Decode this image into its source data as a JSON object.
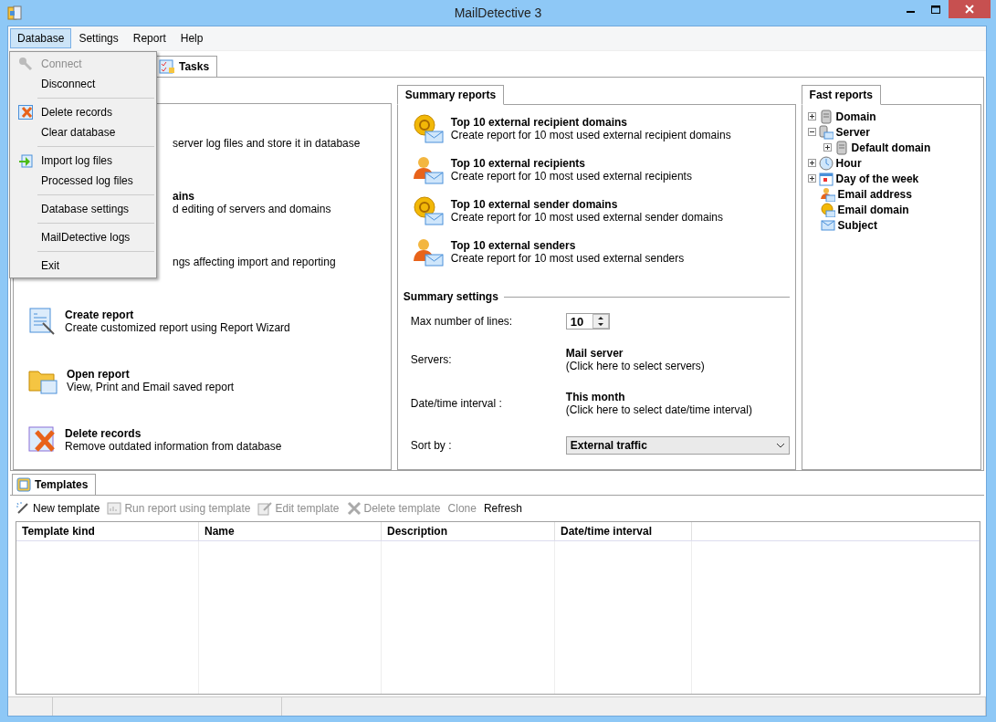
{
  "window": {
    "title": "MailDetective 3"
  },
  "menu_bar": [
    {
      "label": "Database",
      "selected": true
    },
    {
      "label": "Settings",
      "selected": false
    },
    {
      "label": "Report",
      "selected": false
    },
    {
      "label": "Help",
      "selected": false
    }
  ],
  "database_menu": [
    [
      {
        "label": "Connect",
        "disabled": true
      },
      {
        "label": "Disconnect",
        "disabled": false
      }
    ],
    [
      {
        "label": "Delete records",
        "disabled": false
      },
      {
        "label": "Clear database",
        "disabled": false
      }
    ],
    [
      {
        "label": "Import log files",
        "disabled": false
      },
      {
        "label": "Processed log files",
        "disabled": false
      }
    ],
    [
      {
        "label": "Database settings",
        "disabled": false
      }
    ],
    [
      {
        "label": "MailDetective logs",
        "disabled": false
      }
    ],
    [
      {
        "label": "Exit",
        "disabled": false
      }
    ]
  ],
  "main_tabs": [
    {
      "label": "Tasks",
      "selected": true
    }
  ],
  "tasks": [
    {
      "description": "server log files and store it in database"
    },
    {
      "title": "ains",
      "description": "d editing of servers and domains"
    },
    {
      "description": "ngs affecting import and reporting"
    },
    {
      "title": "Create report",
      "description": "Create customized report using Report Wizard"
    },
    {
      "title": "Open report",
      "description": "View, Print and Email saved report"
    },
    {
      "title": "Delete records",
      "description": "Remove outdated information from database"
    }
  ],
  "summary_reports": {
    "tab": "Summary reports",
    "items": [
      {
        "title": "Top 10 external recipient domains",
        "description": "Create report for 10 most used external recipient domains"
      },
      {
        "title": "Top 10 external recipients",
        "description": "Create report for 10 most used external recipients"
      },
      {
        "title": "Top 10 external sender domains",
        "description": "Create report for 10 most used external sender domains"
      },
      {
        "title": "Top 10 external senders",
        "description": "Create report for 10 most used external senders"
      }
    ]
  },
  "summary_settings": {
    "heading": "Summary settings",
    "max_lines": {
      "label": "Max number of lines:",
      "value": "10"
    },
    "servers": {
      "label": "Servers:",
      "value": "Mail server",
      "hint": "(Click here to select servers)"
    },
    "interval": {
      "label": "Date/time interval :",
      "value": "This month",
      "hint": "(Click here to select date/time interval)"
    },
    "sort_by": {
      "label": "Sort by :",
      "value": "External traffic"
    }
  },
  "fast_reports": {
    "tab": "Fast reports",
    "tree": [
      {
        "label": "Domain",
        "expanded": false
      },
      {
        "label": "Server",
        "expanded": true,
        "children": [
          {
            "label": "Default domain",
            "expanded": false
          }
        ]
      },
      {
        "label": "Hour",
        "expanded": false
      },
      {
        "label": "Day of the week",
        "expanded": false
      },
      {
        "label": "Email address"
      },
      {
        "label": "Email domain"
      },
      {
        "label": "Subject"
      }
    ]
  },
  "templates": {
    "tab": "Templates",
    "toolbar": [
      {
        "label": "New template",
        "disabled": false
      },
      {
        "label": "Run report using template",
        "disabled": true
      },
      {
        "label": "Edit template",
        "disabled": true
      },
      {
        "label": "Delete template",
        "disabled": true
      },
      {
        "label": "Clone",
        "disabled": true
      },
      {
        "label": "Refresh",
        "disabled": false
      }
    ],
    "columns": [
      "Template kind",
      "Name",
      "Description",
      "Date/time interval"
    ]
  }
}
